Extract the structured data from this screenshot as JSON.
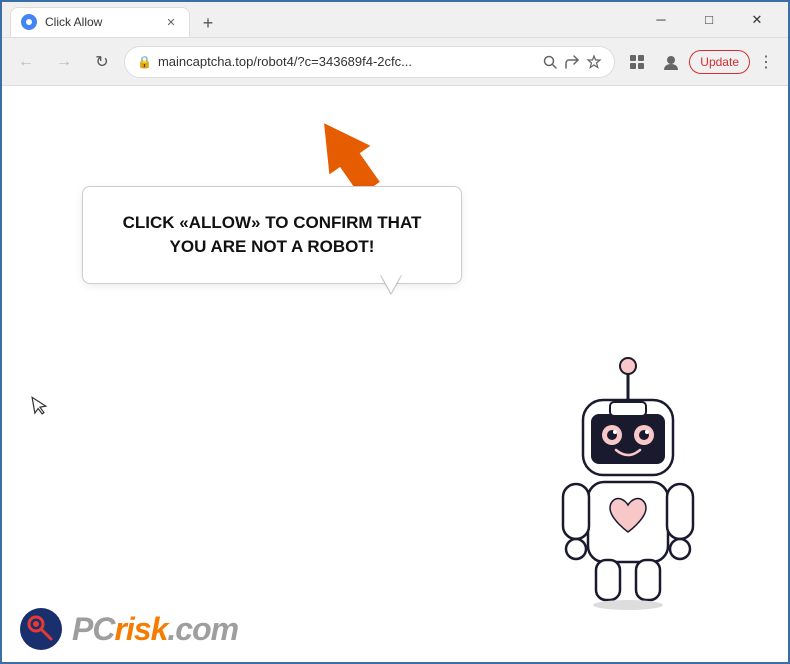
{
  "window": {
    "title": "Click Allow",
    "controls": {
      "minimize": "─",
      "maximize": "□",
      "close": "✕"
    }
  },
  "tab": {
    "title": "Click Allow",
    "close": "✕"
  },
  "toolbar": {
    "back": "←",
    "forward": "→",
    "refresh": "↻",
    "url": "maincaptcha.top/robot4/?c=343689f4-2cfc...",
    "update_label": "Update",
    "new_tab": "+"
  },
  "bubble": {
    "text": "CLICK «ALLOW» TO CONFIRM THAT YOU ARE NOT A ROBOT!"
  },
  "watermark": {
    "text_gray": "PC",
    "text_orange": "risk",
    "domain": ".com"
  }
}
